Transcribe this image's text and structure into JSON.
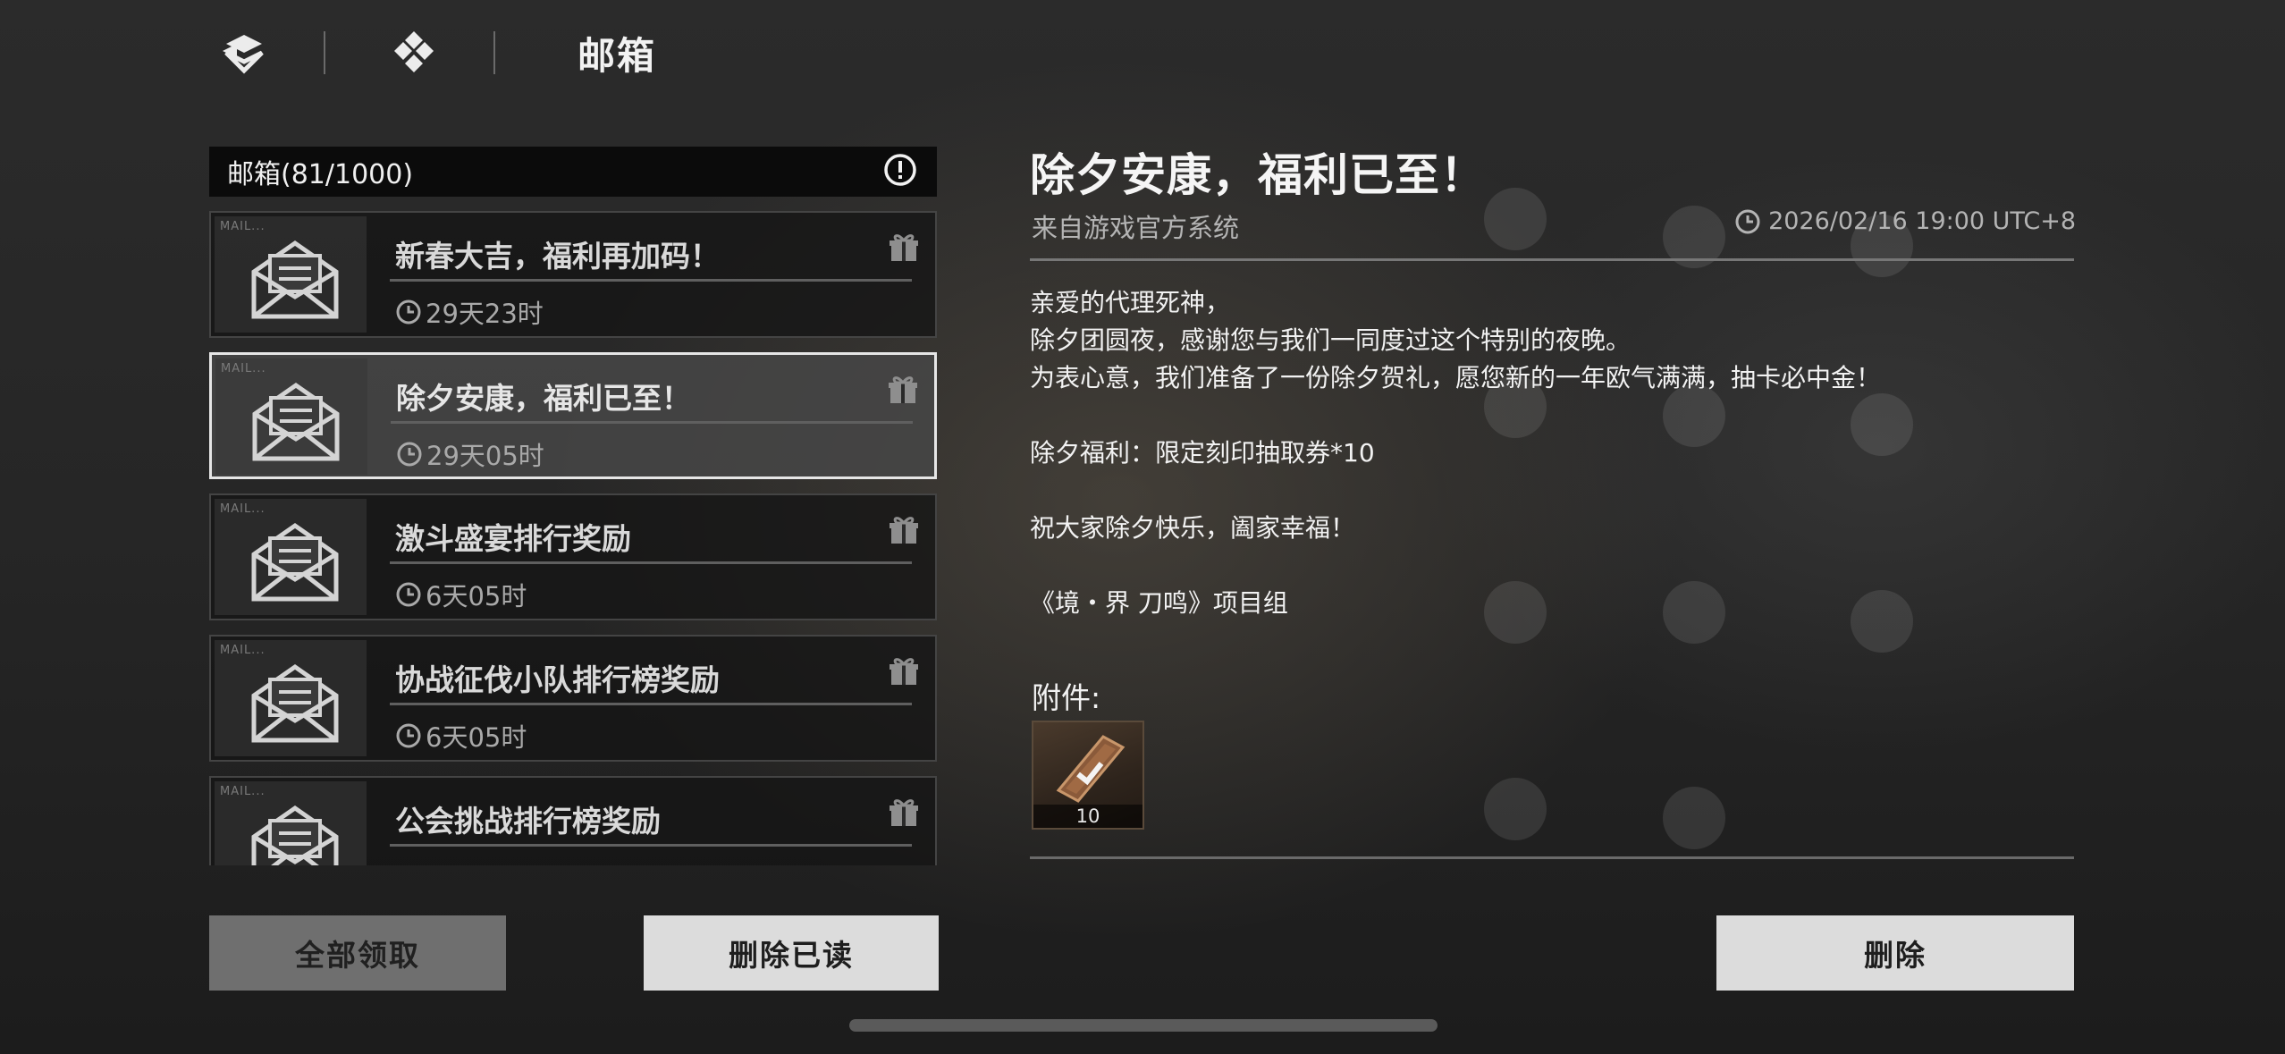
{
  "header": {
    "title": "邮箱"
  },
  "mailbox": {
    "header_label": "邮箱(81/1000)",
    "items": [
      {
        "tag": "MAIL...",
        "title": "新春大吉，福利再加码！",
        "timer": "29天23时",
        "selected": false
      },
      {
        "tag": "MAIL...",
        "title": "除夕安康，福利已至！",
        "timer": "29天05时",
        "selected": true
      },
      {
        "tag": "MAIL...",
        "title": "激斗盛宴排行奖励",
        "timer": "6天05时",
        "selected": false
      },
      {
        "tag": "MAIL...",
        "title": "协战征伐小队排行榜奖励",
        "timer": "6天05时",
        "selected": false
      },
      {
        "tag": "MAIL...",
        "title": "公会挑战排行榜奖励",
        "timer": "",
        "selected": false
      }
    ]
  },
  "detail": {
    "title": "除夕安康，福利已至！",
    "sender": "来自游戏官方系统",
    "date": "2026/02/16 19:00 UTC+8",
    "body": {
      "line1": "亲爱的代理死神，",
      "line2": "除夕团圆夜，感谢您与我们一同度过这个特别的夜晚。",
      "line3": "为表心意，我们准备了一份除夕贺礼，愿您新的一年欧气满满，抽卡必中金！",
      "line4": "除夕福利：限定刻印抽取券*10",
      "line5": "祝大家除夕快乐，阖家幸福！",
      "line6": "《境・界 刀鸣》项目组"
    },
    "attachments_label": "附件:",
    "attachment": {
      "icon": "ticket-icon",
      "count": "10"
    }
  },
  "buttons": {
    "claim_all": "全部领取",
    "delete_read": "删除已读",
    "delete": "删除"
  },
  "colors": {
    "selected_border": "#e6e6e6",
    "button_light": "#dcdcdc",
    "button_disabled": "#6f6f6f"
  }
}
